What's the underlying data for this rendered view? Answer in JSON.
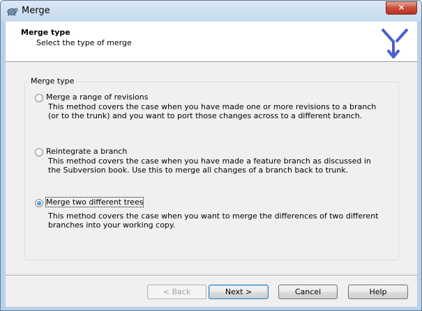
{
  "window": {
    "title": "Merge",
    "close_glyph": "✕"
  },
  "header": {
    "title": "Merge type",
    "subtitle": "Select the type of merge",
    "logo": "merge-arrows-icon"
  },
  "group": {
    "label": "Merge type",
    "options": [
      {
        "label": "Merge a range of revisions",
        "description": "This method covers the case when you have made one or more revisions to a branch (or to the trunk) and you want to port those changes across to a different branch.",
        "checked": false
      },
      {
        "label": "Reintegrate a branch",
        "description": "This method covers the case when you have made a feature branch as discussed in the Subversion book. Use this to merge all changes of a branch back to trunk.",
        "checked": false
      },
      {
        "label": "Merge two different trees",
        "description": "This method covers the case when you want to merge the differences of two different branches into your working copy.",
        "checked": true
      }
    ]
  },
  "buttons": {
    "back": "< Back",
    "next": "Next >",
    "cancel": "Cancel",
    "help": "Help"
  }
}
